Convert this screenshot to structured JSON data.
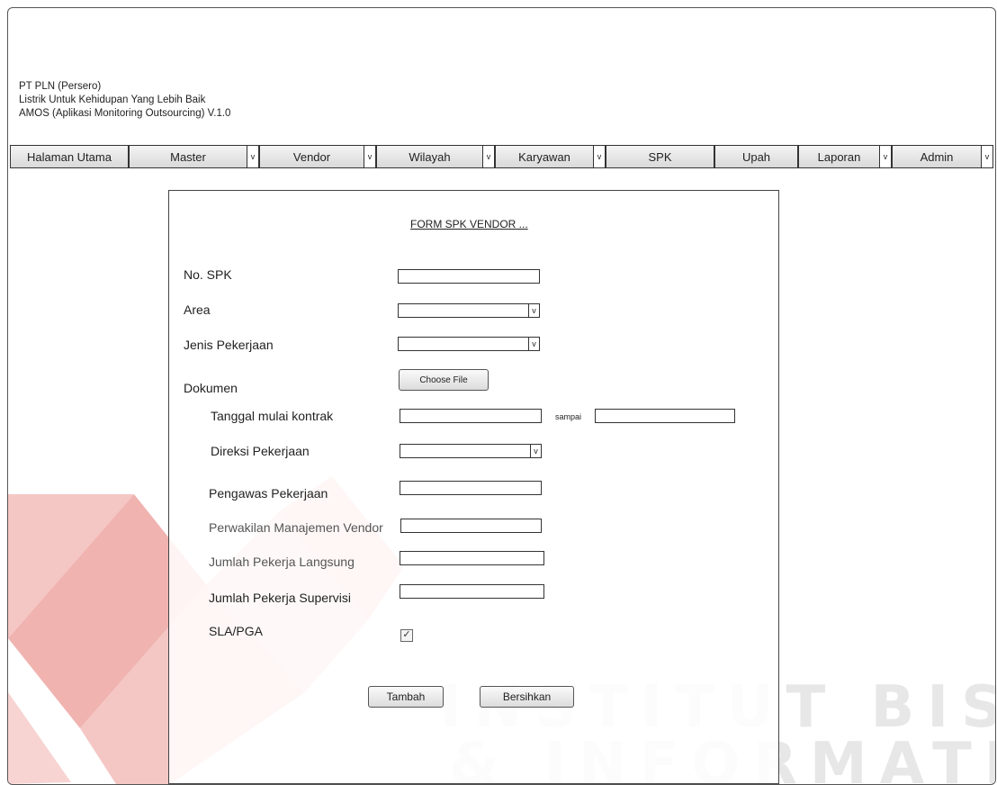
{
  "brand": {
    "company": "PT PLN (Persero)",
    "tagline": "Listrik Untuk Kehidupan Yang Lebih Baik",
    "app": "AMOS (Aplikasi Monitoring Outsourcing) V.1.0"
  },
  "menu": [
    {
      "label": "Halaman Utama",
      "dropdown": false
    },
    {
      "label": "Master",
      "dropdown": true
    },
    {
      "label": "Vendor",
      "dropdown": true
    },
    {
      "label": "Wilayah",
      "dropdown": true
    },
    {
      "label": "Karyawan",
      "dropdown": true
    },
    {
      "label": "SPK",
      "dropdown": false
    },
    {
      "label": "Upah",
      "dropdown": false
    },
    {
      "label": "Laporan",
      "dropdown": true
    },
    {
      "label": "Admin",
      "dropdown": true
    }
  ],
  "caret_glyph": "v",
  "form": {
    "title": "FORM SPK VENDOR ...",
    "fields": {
      "no_spk": {
        "label": "No. SPK",
        "value": ""
      },
      "area": {
        "label": "Area",
        "value": ""
      },
      "jenis_pekerjaan": {
        "label": "Jenis Pekerjaan",
        "value": ""
      },
      "dokumen": {
        "label": "Dokumen",
        "button": "Choose File"
      },
      "tanggal": {
        "label": "Tanggal mulai kontrak",
        "sep": "sampai",
        "from": "",
        "to": ""
      },
      "direksi": {
        "label": "Direksi Pekerjaan",
        "value": ""
      },
      "pengawas": {
        "label": "Pengawas Pekerjaan",
        "value": ""
      },
      "perwakilan": {
        "label": "Perwakilan Manajemen Vendor",
        "value": ""
      },
      "jumlah_langsung": {
        "label": "Jumlah Pekerja Langsung",
        "value": ""
      },
      "jumlah_supervisi": {
        "label": "Jumlah Pekerja Supervisi",
        "value": ""
      },
      "sla": {
        "label": "SLA/PGA",
        "checked": true,
        "mark": "✓"
      }
    },
    "buttons": {
      "add": "Tambah",
      "clear": "Bersihkan"
    }
  },
  "watermark": {
    "line1": "INSTITUT BISNIS",
    "line2": "& INFORMATIKA"
  },
  "colors": {
    "watermark_red": "#d9534f",
    "watermark_gray": "#e7e7e7"
  }
}
